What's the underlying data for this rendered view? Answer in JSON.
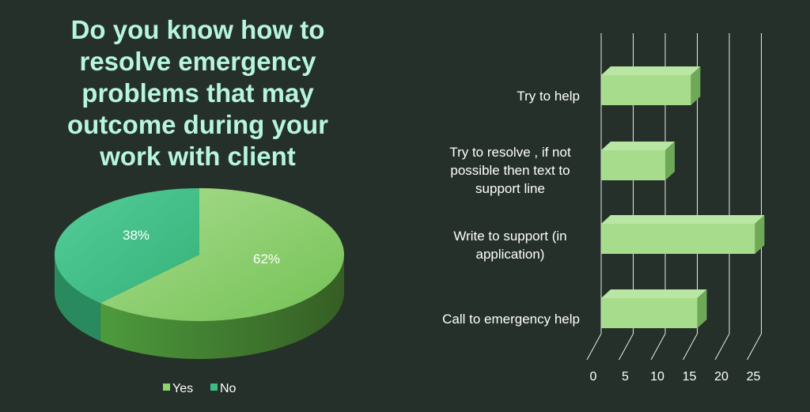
{
  "title_lines": [
    "Do you know how to",
    "resolve emergency",
    "problems that may",
    "outcome during your",
    "work with client"
  ],
  "colors": {
    "background": "#25302a",
    "title": "#b7f5dd",
    "yes": "#8fd46c",
    "no": "#3dbd86",
    "bar": "#a7dc8c"
  },
  "chart_data": [
    {
      "type": "pie",
      "style": "3d",
      "categories": [
        "Yes",
        "No"
      ],
      "values": [
        62,
        38
      ],
      "data_labels": [
        "62%",
        "38%"
      ],
      "legend": {
        "position": "bottom",
        "entries": [
          "Yes",
          "No"
        ]
      }
    },
    {
      "type": "bar",
      "orientation": "horizontal",
      "style": "3d",
      "categories": [
        "Try to help",
        "Try to resolve , if not possible then text to support line",
        "Write to support (in application)",
        "Call to emergency help"
      ],
      "category_label_lines": [
        [
          "Try to help"
        ],
        [
          "Try to resolve , if not",
          "possible then text to",
          "support line"
        ],
        [
          "Write to support (in",
          "application)"
        ],
        [
          "Call to emergency help"
        ]
      ],
      "values": [
        14,
        10,
        24,
        15
      ],
      "xlim": [
        0,
        25
      ],
      "xticks": [
        "0",
        "5",
        "10",
        "15",
        "20",
        "25"
      ],
      "grid": true
    }
  ]
}
